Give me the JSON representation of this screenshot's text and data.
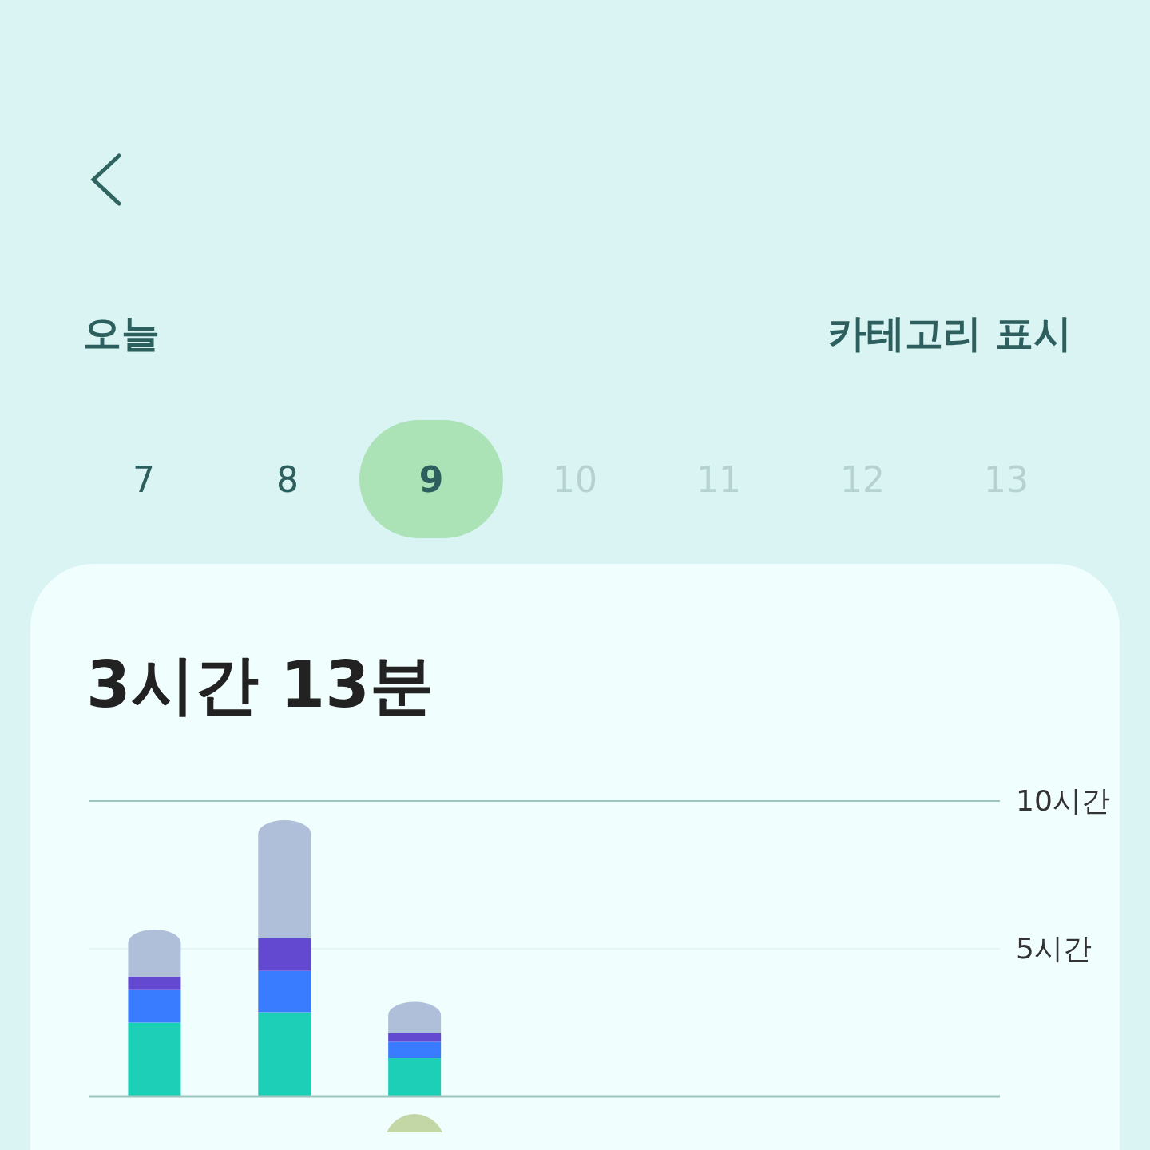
{
  "header": {
    "today": "오늘",
    "category_toggle": "카테고리 표시"
  },
  "days": [
    {
      "label": "7",
      "selected": false,
      "disabled": false
    },
    {
      "label": "8",
      "selected": false,
      "disabled": false
    },
    {
      "label": "9",
      "selected": true,
      "disabled": false
    },
    {
      "label": "10",
      "selected": false,
      "disabled": true
    },
    {
      "label": "11",
      "selected": false,
      "disabled": true
    },
    {
      "label": "12",
      "selected": false,
      "disabled": true
    },
    {
      "label": "13",
      "selected": false,
      "disabled": true
    }
  ],
  "summary": {
    "total": "3시간 13분",
    "chart_data": {
      "type": "bar",
      "stacked": true,
      "ylim": [
        0,
        10
      ],
      "yticks": [
        {
          "value": 5,
          "label": "5시간"
        },
        {
          "value": 10,
          "label": "10시간"
        }
      ],
      "series": [
        {
          "color": "#1ecfb8",
          "values": [
            2.5,
            2.85,
            1.3,
            null,
            null,
            null,
            null
          ]
        },
        {
          "color": "#3a7cff",
          "values": [
            1.1,
            1.4,
            0.55,
            null,
            null,
            null,
            null
          ]
        },
        {
          "color": "#6349d0",
          "values": [
            0.45,
            1.1,
            0.3,
            null,
            null,
            null,
            null
          ]
        },
        {
          "color": "#b0bfd9",
          "values": [
            1.6,
            4.0,
            1.05,
            null,
            null,
            null,
            null
          ]
        }
      ]
    }
  }
}
